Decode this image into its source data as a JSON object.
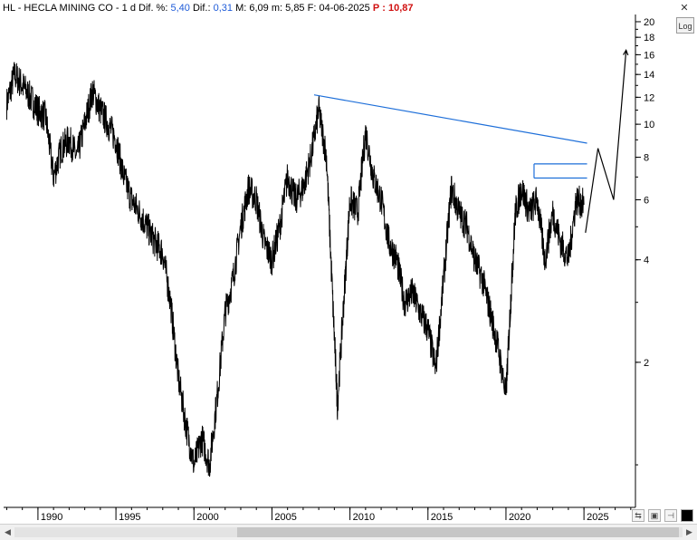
{
  "header": {
    "symbol_name": "HL - HECLA MINING CO",
    "interval": "1 d",
    "diff_pct_label": "Dif. %:",
    "diff_pct_value": "5,40",
    "diff_label": "Dif.:",
    "diff_value": "0,31",
    "max_label": "M:",
    "max_value": "6,09",
    "min_label": "m:",
    "min_value": "5,85",
    "date_label": "F:",
    "date_value": "04-06-2025",
    "price_label": "P",
    "price_value": "10,87"
  },
  "toolbar": {
    "log_label": "Log",
    "close_icon": "close-icon",
    "zoom_icon": "zoom-icon",
    "save_icon": "save-icon",
    "pin_icon": "pin-icon",
    "color_icon": "color-square-icon"
  },
  "colors": {
    "price_line": "#000000",
    "trend_line": "#1e6fd9",
    "highlight_blue": "#1e5bd8",
    "highlight_red": "#d01010"
  },
  "chart_data": {
    "type": "line",
    "yscale": "log",
    "ylim": [
      0.75,
      21
    ],
    "xlim": [
      1987.8,
      2028.3
    ],
    "y_ticks": [
      2,
      4,
      6,
      8,
      10,
      12,
      14,
      16,
      18,
      20
    ],
    "x_ticks": [
      1990,
      1995,
      2000,
      2005,
      2010,
      2015,
      2020,
      2025
    ],
    "x_tick_labels": [
      "1990",
      "1995",
      "2000",
      "2005",
      "2010",
      "2015",
      "2020",
      "2025"
    ],
    "series": [
      {
        "x": [
          1988.0,
          1988.5,
          1989.0,
          1989.5,
          1990.0,
          1990.5,
          1991.0,
          1991.5,
          1992.0,
          1992.5,
          1993.0,
          1993.5,
          1994.0,
          1994.5,
          1995.0,
          1995.5,
          1996.0,
          1996.5,
          1997.0,
          1997.5,
          1998.0,
          1998.5,
          1999.0,
          1999.5,
          2000.0,
          2000.5,
          2001.0,
          2001.5,
          2002.0,
          2002.5,
          2003.0,
          2003.5,
          2004.0,
          2004.5,
          2005.0,
          2005.5,
          2006.0,
          2006.5,
          2007.0,
          2007.5,
          2008.0,
          2008.5,
          2008.9,
          2009.2,
          2009.6,
          2010.0,
          2010.5,
          2011.0,
          2011.5,
          2012.0,
          2012.5,
          2013.0,
          2013.5,
          2014.0,
          2014.5,
          2015.0,
          2015.5,
          2016.0,
          2016.5,
          2017.0,
          2017.5,
          2018.0,
          2018.5,
          2019.0,
          2019.5,
          2020.0,
          2020.3,
          2020.6,
          2021.0,
          2021.5,
          2022.0,
          2022.5,
          2023.0,
          2023.5,
          2024.0,
          2024.5,
          2025.0
        ],
        "y": [
          11.5,
          14.0,
          13.0,
          12.0,
          11.0,
          10.5,
          7.0,
          8.5,
          9.0,
          8.0,
          10.0,
          12.5,
          11.0,
          10.0,
          9.0,
          7.0,
          6.0,
          5.5,
          5.0,
          4.5,
          4.2,
          3.0,
          1.8,
          1.3,
          1.0,
          1.2,
          1.0,
          1.6,
          2.8,
          3.5,
          5.0,
          6.5,
          6.0,
          4.5,
          4.0,
          5.0,
          7.0,
          6.0,
          6.5,
          8.0,
          11.0,
          8.0,
          3.0,
          1.5,
          3.0,
          6.0,
          5.5,
          9.5,
          7.0,
          6.0,
          4.5,
          4.0,
          3.0,
          3.2,
          2.8,
          2.5,
          1.9,
          3.5,
          6.5,
          5.5,
          5.0,
          4.0,
          3.5,
          2.8,
          2.2,
          1.6,
          3.0,
          5.5,
          6.5,
          5.5,
          6.0,
          4.0,
          5.5,
          4.5,
          4.0,
          6.0,
          5.8
        ]
      }
    ],
    "annotations": [
      {
        "type": "trendline",
        "from": [
          2007.7,
          12.2
        ],
        "to": [
          2025.2,
          8.8
        ]
      },
      {
        "type": "channel",
        "x_start": 2021.8,
        "x_end": 2025.2,
        "upper": 7.65,
        "lower": 6.95
      },
      {
        "type": "projection",
        "points": [
          [
            2025.1,
            4.8
          ],
          [
            2025.9,
            8.5
          ],
          [
            2026.9,
            6.0
          ],
          [
            2027.7,
            16.5
          ]
        ]
      }
    ]
  }
}
